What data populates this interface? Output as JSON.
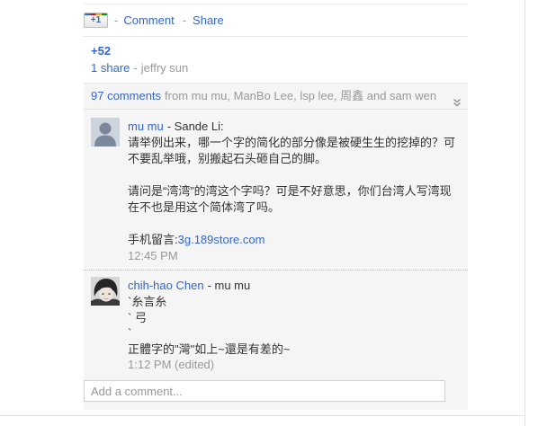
{
  "post_actions": {
    "plus_one_label": "+1",
    "separator": "-",
    "comment_label": "Comment",
    "share_label": "Share"
  },
  "post_stats": {
    "plus_one_count": "+52",
    "shares_label": "1 share",
    "sharer_separator": "-",
    "sharer_name": "jeffry sun"
  },
  "comments_header": {
    "count_label": "97 comments",
    "participants": "from mu mu, ManBo Lee, lsp lee, 周鑫 and sam wen"
  },
  "comments": [
    {
      "author": "mu mu",
      "reply_to": "- Sande Li:",
      "paragraphs": [
        [
          "请举例出来，哪一个字的简化的部分像是被硬生生的挖掉的？可",
          "不要乱举哦，别搬起石头砸自己的脚。"
        ],
        [
          "请问是“湾湾”的湾这个字吗？可是不好意思，你们台湾人写湾现",
          "在不也是用这个简体湾了吗。"
        ]
      ],
      "link_prefix": "手机留言:",
      "link_text": "3g.189store.com",
      "time": "12:45 PM"
    },
    {
      "author": "chih-hao Chen",
      "reply_to": "- mu mu",
      "lines": [
        "`糸言糸",
        "` 弓",
        "`",
        "正體字的\"灣\"如上~還是有差的~"
      ],
      "time": "1:12 PM (edited)"
    }
  ],
  "add_comment": {
    "placeholder": "Add a comment..."
  },
  "icons": {
    "plus_one": "plus-one-icon",
    "expand_comments": "double-chevron-down-icon",
    "default_avatar": "default-avatar-silhouette-icon"
  },
  "colors": {
    "link": "#3366cc",
    "muted": "#999999",
    "text": "#333333",
    "comments_background": "#f5f5f5",
    "input_border": "#d0d0d0"
  }
}
